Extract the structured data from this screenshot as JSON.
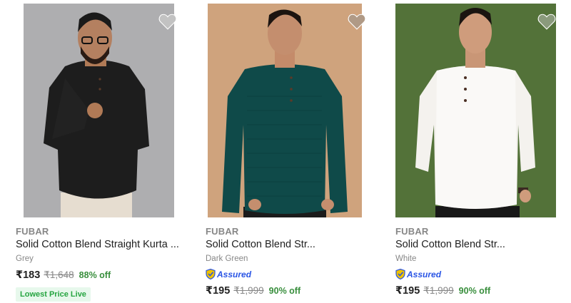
{
  "products": [
    {
      "brand": "FUBAR",
      "title": "Solid Cotton Blend Straight Kurta ...",
      "color": "Grey",
      "price": "₹183",
      "mrp": "₹1,648",
      "discount": "88% off",
      "badge": "Lowest Price Live",
      "wishlist_icon": "heart-icon"
    },
    {
      "brand": "FUBAR",
      "title": "Solid Cotton Blend Str...",
      "color": "Dark Green",
      "assured": "Assured",
      "price": "₹195",
      "mrp": "₹1,999",
      "discount": "90% off",
      "wishlist_icon": "heart-icon"
    },
    {
      "brand": "FUBAR",
      "title": "Solid Cotton Blend Str...",
      "color": "White",
      "assured": "Assured",
      "price": "₹195",
      "mrp": "₹1,999",
      "discount": "90% off",
      "wishlist_icon": "heart-icon"
    }
  ],
  "colors": {
    "discount": "#388e3c",
    "assured": "#2a55e5",
    "badge_bg": "#e7f8ec",
    "muted_text": "#878787"
  }
}
